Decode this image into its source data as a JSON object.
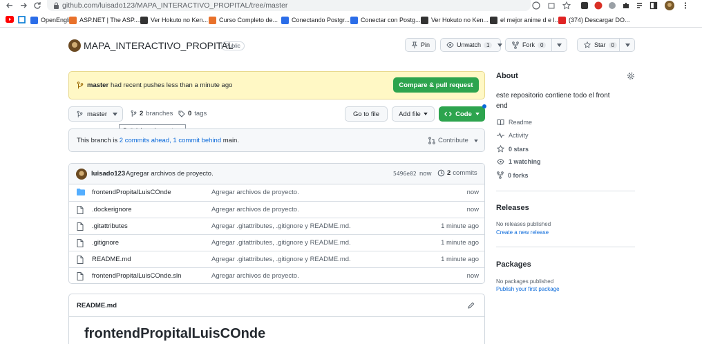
{
  "browser": {
    "url": "github.com/luisado123/MAPA_INTERACTIVO_PROPITAL/tree/master",
    "bookmarks": [
      {
        "label": "OpenEnglish",
        "color": "#2b6de8"
      },
      {
        "label": "ASP.NET | The ASP....",
        "color": "#e8712b"
      },
      {
        "label": "Ver Hokuto no Ken...",
        "color": "#333333"
      },
      {
        "label": "Curso Completo de...",
        "color": "#e8712b"
      },
      {
        "label": "Conectando Postgr...",
        "color": "#2b6de8"
      },
      {
        "label": "Conectar con Postg...",
        "color": "#2b6de8"
      },
      {
        "label": "Ver Hokuto no Ken...",
        "color": "#333333"
      },
      {
        "label": "el mejor anime d e l...",
        "color": "#333333"
      },
      {
        "label": "(374) Descargar DO...",
        "color": "#e02424"
      }
    ]
  },
  "repo": {
    "name": "MAPA_INTERACTIVO_PROPITAL",
    "visibility": "Public",
    "pin_label": "Pin",
    "unwatch_label": "Unwatch",
    "unwatch_count": "1",
    "fork_label": "Fork",
    "fork_count": "0",
    "star_label": "Star",
    "star_count": "0"
  },
  "banner": {
    "branch": "master",
    "text": "had recent pushes less than a minute ago",
    "button": "Compare & pull request"
  },
  "toolbar": {
    "branch": "master",
    "branches_count": "2",
    "branches_label": "branches",
    "tags_count": "0",
    "tags_label": "tags",
    "tooltip": "Switch branches or tags",
    "go_to_file": "Go to file",
    "add_file": "Add file",
    "code": "Code"
  },
  "ahead": {
    "prefix": "This branch is",
    "ahead_link": "2 commits ahead,",
    "behind_link": "1 commit behind",
    "suffix": "main.",
    "contribute": "Contribute"
  },
  "latest_commit": {
    "author": "luisado123",
    "message": "Agregar archivos de proyecto.",
    "sha": "5496e02",
    "when": "now",
    "commits_count": "2",
    "commits_label": "commits"
  },
  "files": [
    {
      "name": "frontendPropitalLuisCOnde",
      "type": "folder",
      "message": "Agregar archivos de proyecto.",
      "age": "now"
    },
    {
      "name": ".dockerignore",
      "type": "file",
      "message": "Agregar archivos de proyecto.",
      "age": "now"
    },
    {
      "name": ".gitattributes",
      "type": "file",
      "message": "Agregar .gitattributes, .gitignore y README.md.",
      "age": "1 minute ago"
    },
    {
      "name": ".gitignore",
      "type": "file",
      "message": "Agregar .gitattributes, .gitignore y README.md.",
      "age": "1 minute ago"
    },
    {
      "name": "README.md",
      "type": "file",
      "message": "Agregar .gitattributes, .gitignore y README.md.",
      "age": "1 minute ago"
    },
    {
      "name": "frontendPropitalLuisCOnde.sln",
      "type": "file",
      "message": "Agregar archivos de proyecto.",
      "age": "now"
    }
  ],
  "readme": {
    "filename": "README.md",
    "heading": "frontendPropitalLuisCOnde"
  },
  "sidebar": {
    "about_title": "About",
    "description": "este repositorio contiene todo el front end",
    "readme": "Readme",
    "activity": "Activity",
    "stars": "0 stars",
    "watching": "1 watching",
    "forks": "0 forks",
    "releases_title": "Releases",
    "no_releases": "No releases published",
    "create_release": "Create a new release",
    "packages_title": "Packages",
    "no_packages": "No packages published",
    "publish_package": "Publish your first package"
  },
  "colors": {
    "accent_green": "#2da44e",
    "link_blue": "#0969da",
    "banner_yellow": "#fff8c5"
  }
}
